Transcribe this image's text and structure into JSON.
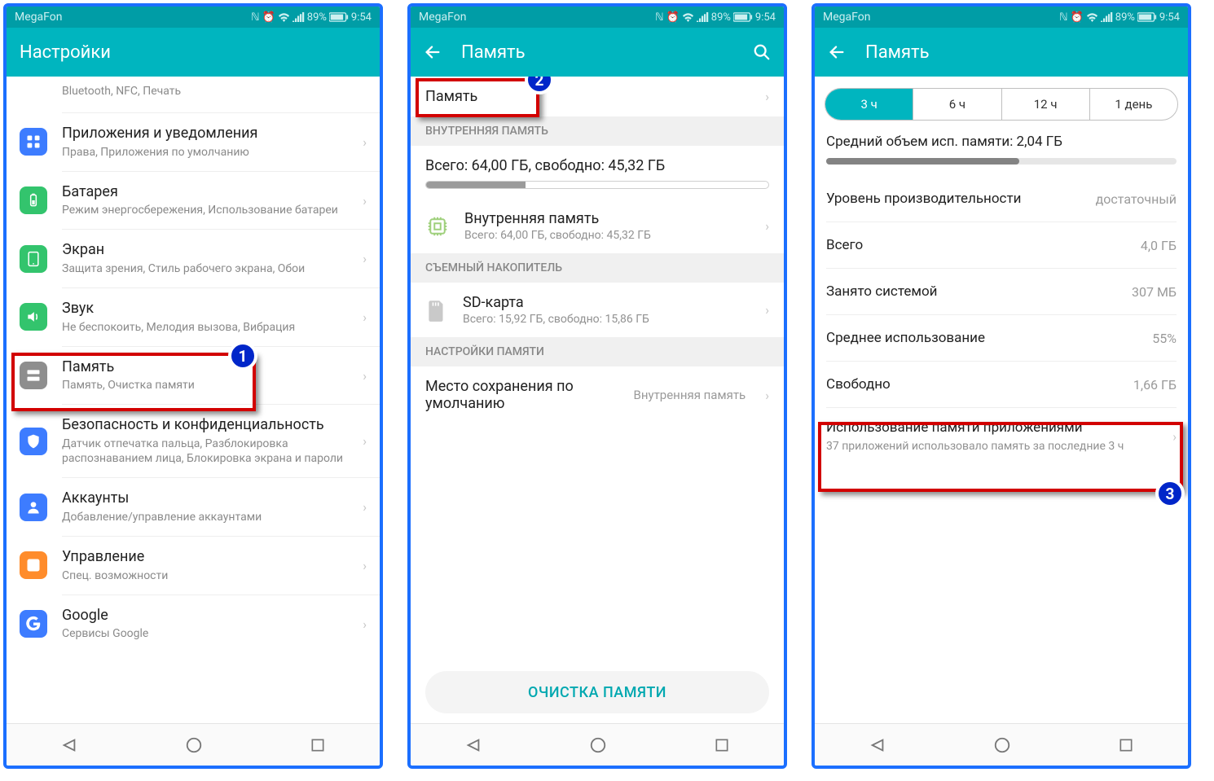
{
  "status": {
    "carrier": "MegaFon",
    "battery_pct": "89%",
    "time": "9:54"
  },
  "nav_shapes": {
    "back": "△",
    "home": "○",
    "recent": "□"
  },
  "callouts": {
    "n1": "1",
    "n2": "2",
    "n3": "3"
  },
  "screen1": {
    "title": "Настройки",
    "partial_sub": "Bluetooth, NFC, Печать",
    "items": [
      {
        "title": "Приложения и уведомления",
        "sub": "Права, Приложения по умолчанию",
        "color": "#3d7cff",
        "icon": "apps"
      },
      {
        "title": "Батарея",
        "sub": "Режим энергосбережения, Использование батареи",
        "color": "#33c46d",
        "icon": "battery"
      },
      {
        "title": "Экран",
        "sub": "Защита зрения, Стиль рабочего экрана, Обои",
        "color": "#33c46d",
        "icon": "display"
      },
      {
        "title": "Звук",
        "sub": "Не беспокоить, Мелодия вызова, Вибрация",
        "color": "#33c46d",
        "icon": "sound"
      },
      {
        "title": "Память",
        "sub": "Память, Очистка памяти",
        "color": "#8e8e8e",
        "icon": "storage"
      },
      {
        "title": "Безопасность и конфиденциальность",
        "sub": "Датчик отпечатка пальца, Разблокировка распознаванием лица, Блокировка экрана и пароли",
        "color": "#3d7cff",
        "icon": "shield"
      },
      {
        "title": "Аккаунты",
        "sub": "Добавление/управление аккаунтами",
        "color": "#3d7cff",
        "icon": "account"
      },
      {
        "title": "Управление",
        "sub": "Спец. возможности",
        "color": "#ff8c2b",
        "icon": "manage"
      },
      {
        "title": "Google",
        "sub": "Сервисы Google",
        "color": "#3d7cff",
        "icon": "google"
      }
    ]
  },
  "screen2": {
    "title": "Память",
    "top_item": "Память",
    "sec_internal": "ВНУТРЕННЯЯ ПАМЯТЬ",
    "internal_summary": "Всего: 64,00 ГБ, свободно: 45,32 ГБ",
    "internal_item_title": "Внутренняя память",
    "internal_item_sub": "Всего: 64,00 ГБ, свободно: 45,32 ГБ",
    "internal_used_pct": 29,
    "sec_removable": "СЪЕМНЫЙ НАКОПИТЕЛЬ",
    "sd_title": "SD-карта",
    "sd_sub": "Всего: 15,92 ГБ, свободно: 15,86 ГБ",
    "sec_settings": "НАСТРОЙКИ ПАМЯТИ",
    "default_loc_title": "Место сохранения по умолчанию",
    "default_loc_value": "Внутренняя память",
    "clean_btn": "ОЧИСТКА ПАМЯТИ"
  },
  "screen3": {
    "title": "Память",
    "segments": [
      "3 ч",
      "6 ч",
      "12 ч",
      "1 день"
    ],
    "avg_label": "Средний объем исп. памяти: 2,04 ГБ",
    "bar_fill_pct": 55,
    "rows": [
      {
        "label": "Уровень производительности",
        "value": "достаточный"
      },
      {
        "label": "Всего",
        "value": "4,0 ГБ"
      },
      {
        "label": "Занято системой",
        "value": "307 МБ"
      },
      {
        "label": "Среднее использование",
        "value": "55%"
      },
      {
        "label": "Свободно",
        "value": "1,66 ГБ"
      }
    ],
    "apps_title": "Использование памяти приложениями",
    "apps_sub": "37 приложений использовало память за последние 3 ч"
  }
}
